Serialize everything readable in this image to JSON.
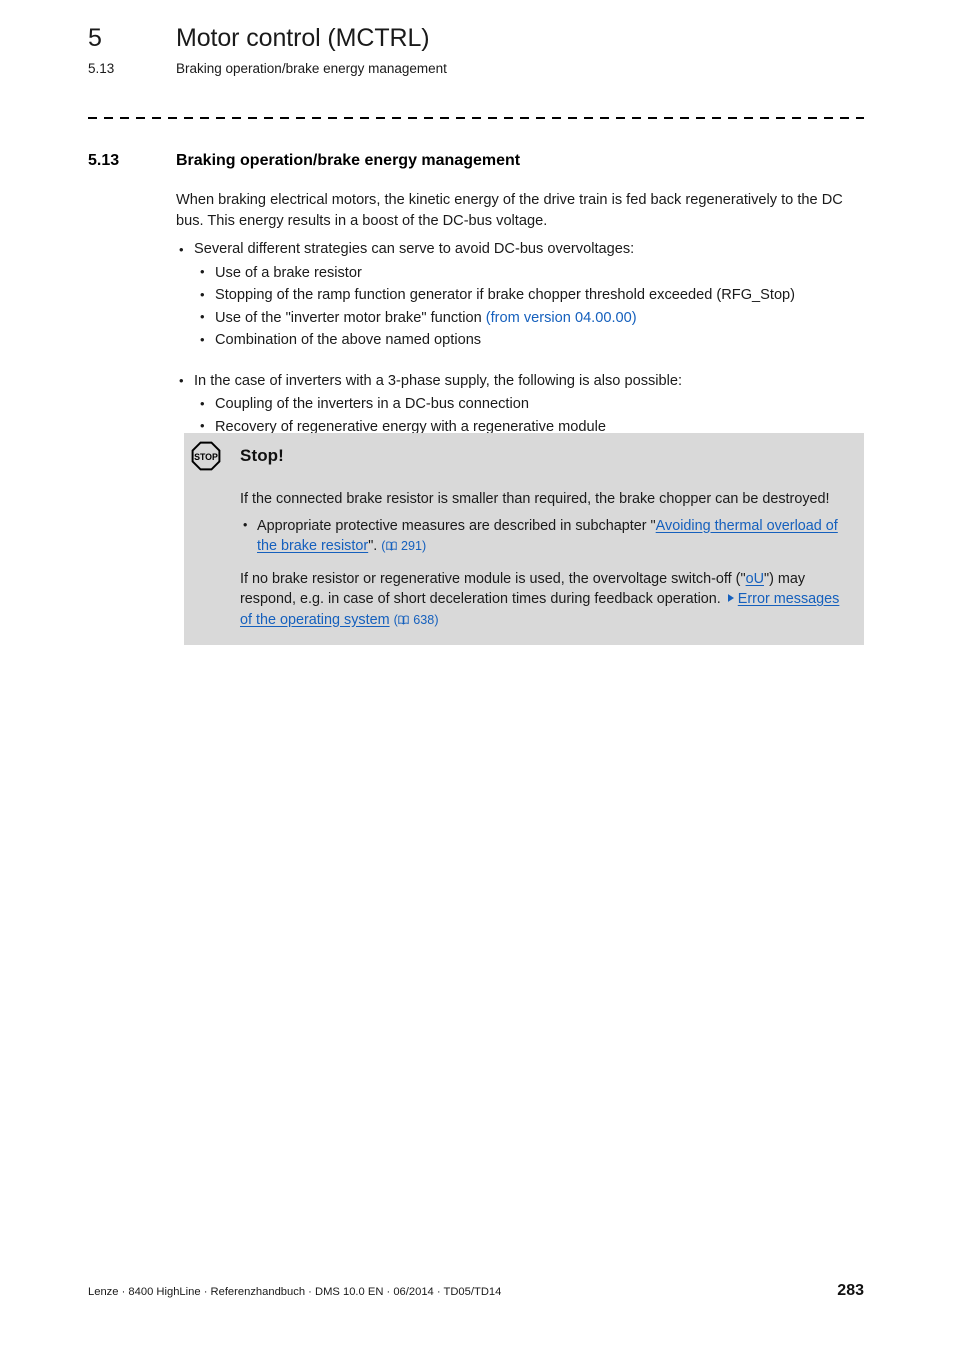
{
  "running_header": {
    "chapter_number": "5",
    "chapter_title": "Motor control (MCTRL)",
    "section_number": "5.13",
    "section_title": "Braking operation/brake energy management"
  },
  "section": {
    "number": "5.13",
    "title": "Braking operation/brake energy management"
  },
  "intro": {
    "paragraph": "When braking electrical motors, the kinetic energy of the drive train is fed back regeneratively to the DC bus. This energy results in a boost of the DC-bus voltage."
  },
  "list_group_1": {
    "lead": "Several different strategies can serve to avoid DC-bus overvoltages:",
    "items": [
      {
        "text": "Use of a brake resistor",
        "note": ""
      },
      {
        "text": "Stopping of the ramp function generator if brake chopper threshold exceeded (RFG_Stop)",
        "note": ""
      },
      {
        "text": "Use of the \"inverter motor brake\" function",
        "note": "(from version 04.00.00)"
      },
      {
        "text": "Combination of the above named options",
        "note": ""
      }
    ]
  },
  "list_group_2": {
    "lead": "In the case of inverters with a 3-phase supply, the following is also possible:",
    "items": [
      {
        "text": "Coupling of the inverters in a DC-bus connection",
        "note": ""
      },
      {
        "text": "Recovery of regenerative energy with a regenerative module",
        "note": ""
      }
    ]
  },
  "warning_box": {
    "icon_label": "STOP",
    "title": "Stop!",
    "paragraph_1": "If the connected brake resistor is smaller than required, the brake chopper can be destroyed!",
    "bullet_1": {
      "prefix": "Appropriate protective measures are described in subchapter \"",
      "link": "Avoiding thermal overload of the brake resistor",
      "suffix": "\".",
      "page_ref": "291"
    },
    "paragraph_2": {
      "part_1": "If no brake resistor or regenerative module is used, the overvoltage switch-off (\"",
      "inline_link": "oU",
      "part_2": "\") may respond, e.g. in case of short deceleration times during feedback operation.",
      "link": "Error messages of the operating system",
      "page_ref": "638"
    }
  },
  "footer": {
    "imprint": "Lenze · 8400 HighLine · Referenzhandbuch · DMS 10.0 EN · 06/2014 · TD05/TD14",
    "page_number": "283"
  },
  "colors": {
    "link_blue": "#1560bd",
    "warn_box_bg": "#d9d9d9",
    "text": "#1a1a1a"
  }
}
